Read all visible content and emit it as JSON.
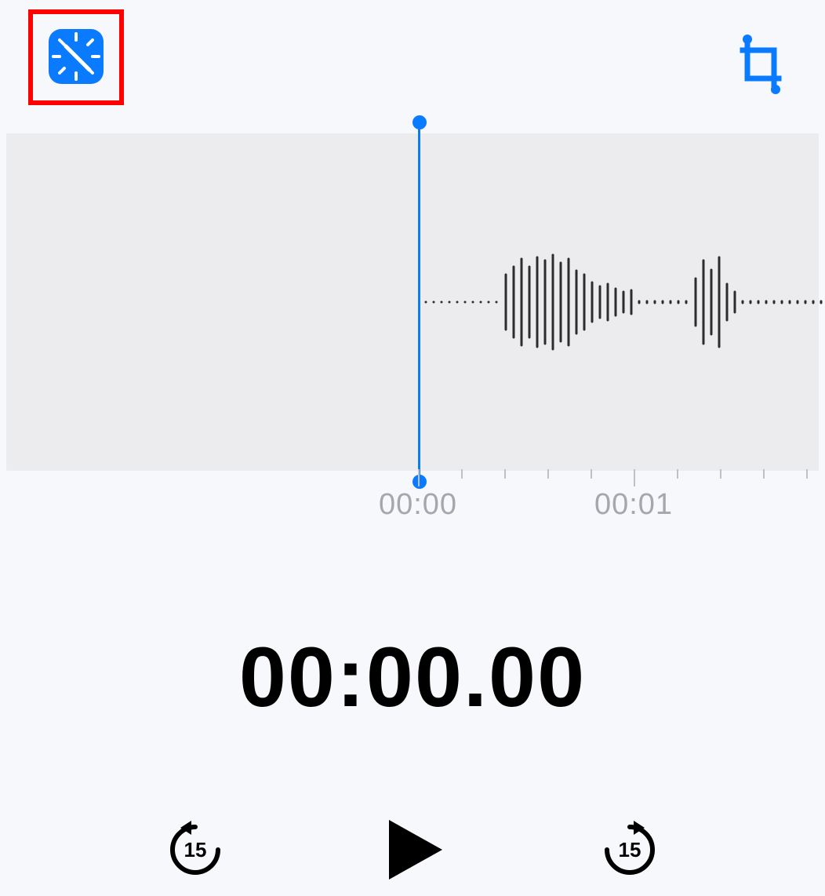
{
  "toolbar": {
    "enhance_icon": "enhance-icon",
    "crop_icon": "crop-icon",
    "enhance_highlighted": true
  },
  "timeline": {
    "labels": [
      "00:00",
      "00:01"
    ],
    "ticks_per_second": 5
  },
  "playback": {
    "current_time": "00:00.00",
    "skip_back_label": "15",
    "skip_forward_label": "15"
  },
  "colors": {
    "accent": "#0a7aff",
    "highlight_border": "#ff0000"
  }
}
